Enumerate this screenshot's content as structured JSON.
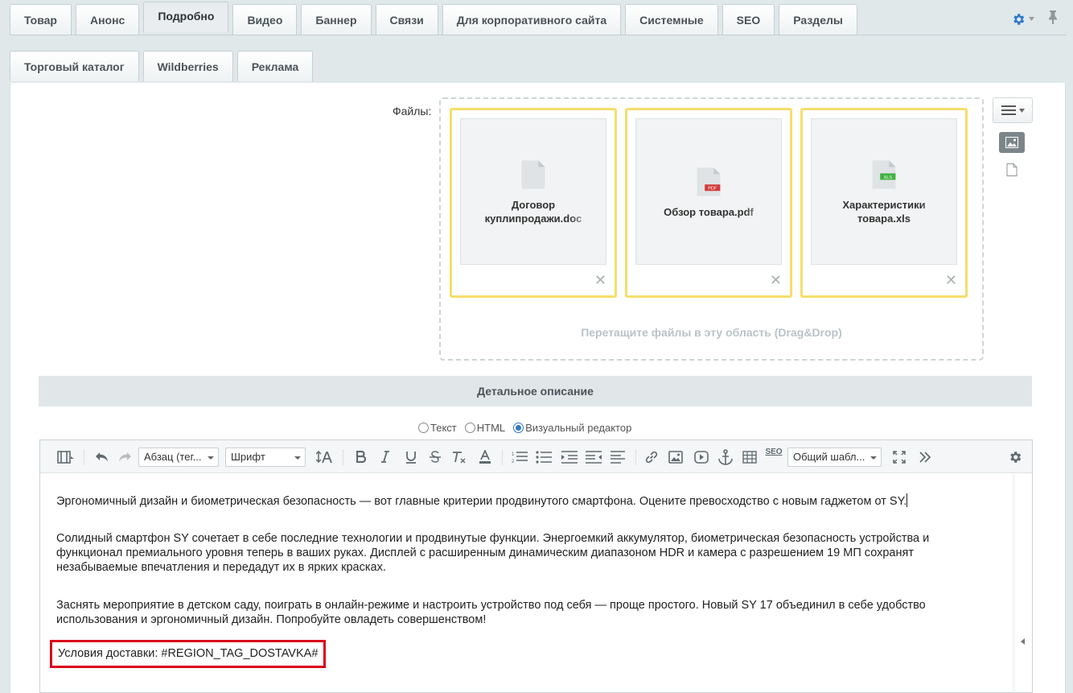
{
  "tabs_row1": [
    "Товар",
    "Анонс",
    "Подробно",
    "Видео",
    "Баннер",
    "Связи",
    "Для корпоративного сайта",
    "Системные",
    "SEO",
    "Разделы"
  ],
  "tabs_row2": [
    "Торговый каталог",
    "Wildberries",
    "Реклама"
  ],
  "active_tab": "Подробно",
  "files": {
    "label": "Файлы:",
    "items": [
      {
        "name": "Договор куплипродажи.doc",
        "type": "doc",
        "badge": ""
      },
      {
        "name": "Обзор товара.pdf",
        "type": "pdf",
        "badge": "PDF"
      },
      {
        "name": "Характеристики товара.xls",
        "type": "xls",
        "badge": "XLS"
      }
    ],
    "drop_hint": "Перетащите файлы в эту область (Drag&Drop)",
    "remove_glyph": "✕"
  },
  "detail_section": {
    "title": "Детальное описание",
    "modes": [
      {
        "label": "Текст",
        "selected": false
      },
      {
        "label": "HTML",
        "selected": false
      },
      {
        "label": "Визуальный редактор",
        "selected": true
      }
    ]
  },
  "toolbar": {
    "paragraph_select": "Абзац (тег...",
    "font_select": "Шрифт",
    "template_select": "Общий шабл...",
    "seo_label": "SEO"
  },
  "content": {
    "paragraphs": [
      "Эргономичный дизайн и биометрическая безопасность — вот главные критерии продвинутого смартфона. Оцените превосходство с новым гаджетом от SY.",
      "Солидный смартфон SY сочетает в себе последние технологии и продвинутые функции. Энергоемкий аккумулятор, биометрическая безопасность устройства и функционал премиального уровня теперь в ваших руках. Дисплей с расширенным динамическим диапазоном HDR и камера с разрешением 19 МП сохранят незабываемые впечатления и передадут их в ярких красках.",
      "Заснять мероприятие в детском саду, поиграть в онлайн-режиме и настроить устройство под себя — проще простого. Новый SY 17 объединил в себе удобство использования и эргономичный дизайн. Попробуйте овладеть совершенством!"
    ],
    "delivery": "Условия доставки: #REGION_TAG_DOSTAVKA#"
  },
  "colors": {
    "file_card_border": "#f5de6b",
    "highlight_border": "#d9001b",
    "pdf_badge": "#d43a3a",
    "xls_badge": "#3fb23f",
    "radio_selected": "#2f78c6"
  }
}
